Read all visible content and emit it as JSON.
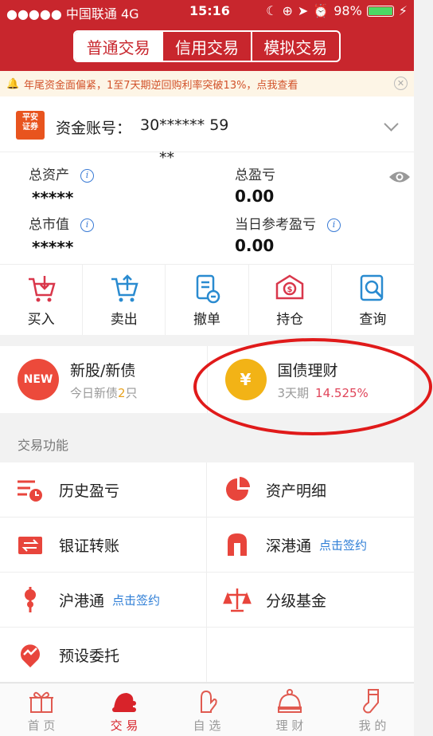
{
  "statusbar": {
    "signal": "●●●●● 中国联通 4G",
    "time": "15:16",
    "battery": "98%"
  },
  "tabs": [
    "普通交易",
    "信用交易",
    "模拟交易"
  ],
  "notice": {
    "text": "年尾资金面偏紧，1至7天期逆回购利率突破13%，点我查看"
  },
  "account": {
    "logo_text": "平安证券",
    "label": "资金账号：",
    "number": "30****** 59",
    "number_cont": "**",
    "total_assets_label": "总资产",
    "total_assets_value": "*****",
    "total_pl_label": "总盈亏",
    "total_pl_value": "0.00",
    "market_value_label": "总市值",
    "market_value_value": "*****",
    "daily_pl_label": "当日参考盈亏",
    "daily_pl_value": "0.00"
  },
  "actions": [
    {
      "label": "买入",
      "icon": "buy-cart-icon"
    },
    {
      "label": "卖出",
      "icon": "sell-cart-icon"
    },
    {
      "label": "撤单",
      "icon": "cancel-order-icon"
    },
    {
      "label": "持仓",
      "icon": "holdings-icon"
    },
    {
      "label": "查询",
      "icon": "query-icon"
    }
  ],
  "products": {
    "new_stock": {
      "title": "新股/新债",
      "sub_prefix": "今日新债",
      "count": "2",
      "sub_suffix": "只",
      "badge": "NEW"
    },
    "treasury": {
      "title": "国债理财",
      "term": "3天期",
      "rate": "14.525%"
    }
  },
  "section_title": "交易功能",
  "functions": [
    {
      "label": "历史盈亏",
      "sign": ""
    },
    {
      "label": "资产明细",
      "sign": ""
    },
    {
      "label": "银证转账",
      "sign": ""
    },
    {
      "label": "深港通",
      "sign": "点击签约"
    },
    {
      "label": "沪港通",
      "sign": "点击签约"
    },
    {
      "label": "分级基金",
      "sign": ""
    },
    {
      "label": "预设委托",
      "sign": ""
    }
  ],
  "nav": [
    {
      "label": "首 页"
    },
    {
      "label": "交 易"
    },
    {
      "label": "自 选"
    },
    {
      "label": "理 财"
    },
    {
      "label": "我 的"
    }
  ],
  "colors": {
    "brand": "#c8262d",
    "accent_icon": "#e8453c",
    "link": "#2e7ed6",
    "rate": "#e0455a"
  }
}
